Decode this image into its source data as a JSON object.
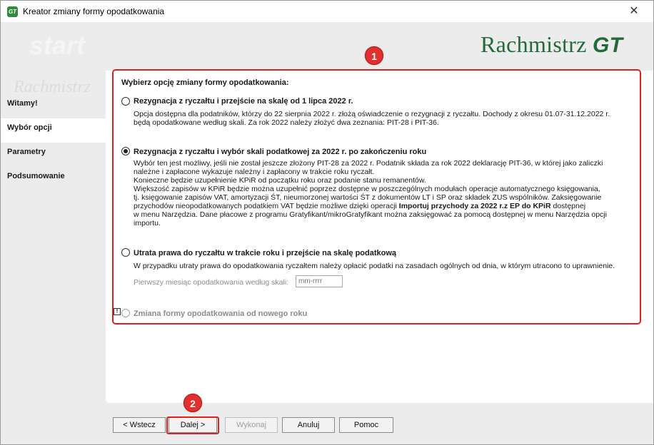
{
  "window": {
    "title": "Kreator zmiany formy opodatkowania",
    "icon_text": "GT",
    "close_glyph": "✕"
  },
  "brand": {
    "name": "Rachmistrz ",
    "suffix": "GT"
  },
  "watermark": {
    "top": "start",
    "bottom": "Rachmistrz"
  },
  "nav": {
    "items": [
      {
        "label": "Witamy!"
      },
      {
        "label": "Wybór opcji"
      },
      {
        "label": "Parametry"
      },
      {
        "label": "Podsumowanie"
      }
    ],
    "active_index": 1
  },
  "annotations": {
    "badge1": "1",
    "badge2": "2"
  },
  "main": {
    "prompt": "Wybierz opcję zmiany formy opodatkowania:",
    "options": [
      {
        "title": "Rezygnacja z ryczałtu i przejście na skalę od 1 lipca 2022 r.",
        "selected": false,
        "lines": [
          "Opcja dostępna dla podatników, którzy do 22 sierpnia 2022 r. złożą oświadczenie o rezygnacji z ryczałtu. Dochody z okresu 01.07-31.12.2022 r.",
          "będą opodatkowane według skali. Za rok 2022 należy złożyć dwa zeznania: PIT-28 i PIT-36."
        ]
      },
      {
        "title": "Rezygnacja z ryczałtu i wybór skali podatkowej za 2022 r. po zakończeniu roku",
        "selected": true,
        "lines": [
          "Wybór ten jest możliwy, jeśli nie został jeszcze złożony PIT-28 za 2022 r. Podatnik składa za rok 2022 deklarację PIT-36, w której jako zaliczki",
          "należne i zapłacone wykazuje należny i zapłacony w trakcie roku ryczałt.",
          "Konieczne będzie uzupełnienie KPiR od początku roku oraz podanie stanu remanentów.",
          "Większość zapisów w KPiR będzie można uzupełnić poprzez dostępne w poszczególnych modułach operacje automatycznego księgowania,",
          "tj. księgowanie zapisów VAT, amortyzacji ŚT, nieumorzonej wartości ŚT z dokumentów LT i SP oraz składek ZUS wspólników. Zaksięgowanie",
          "przychodów nieopodatkowanych podatkiem VAT będzie możliwe dzięki operacji ",
          "dostępnej",
          "w menu Narzędzia. Dane płacowe z programu Gratyfikant/mikroGratyfikant można zaksięgować za pomocą dostępnej w menu Narzędzia opcji",
          "importu."
        ],
        "bold_operation": "Importuj przychody za 2022 r.z EP do KPiR"
      },
      {
        "title": "Utrata prawa do ryczałtu w trakcie roku i przejście na skalę podatkową",
        "selected": false,
        "lines": [
          "W przypadku utraty prawa do opodatkowania ryczałtem należy opłacić podatki na zasadach ogólnych od dnia, w którym utracono to uprawnienie."
        ],
        "field_label": "Pierwszy miesiąc opodatkowania według skali:",
        "field_placeholder": "mm-rrrr"
      },
      {
        "title": "Zmiana formy opodatkowania od nowego roku",
        "selected": false,
        "disabled": true,
        "warn_glyph": "!"
      }
    ]
  },
  "buttons": {
    "back": "< Wstecz",
    "next": "Dalej >",
    "execute": "Wykonaj",
    "cancel": "Anuluj",
    "help": "Pomoc"
  }
}
